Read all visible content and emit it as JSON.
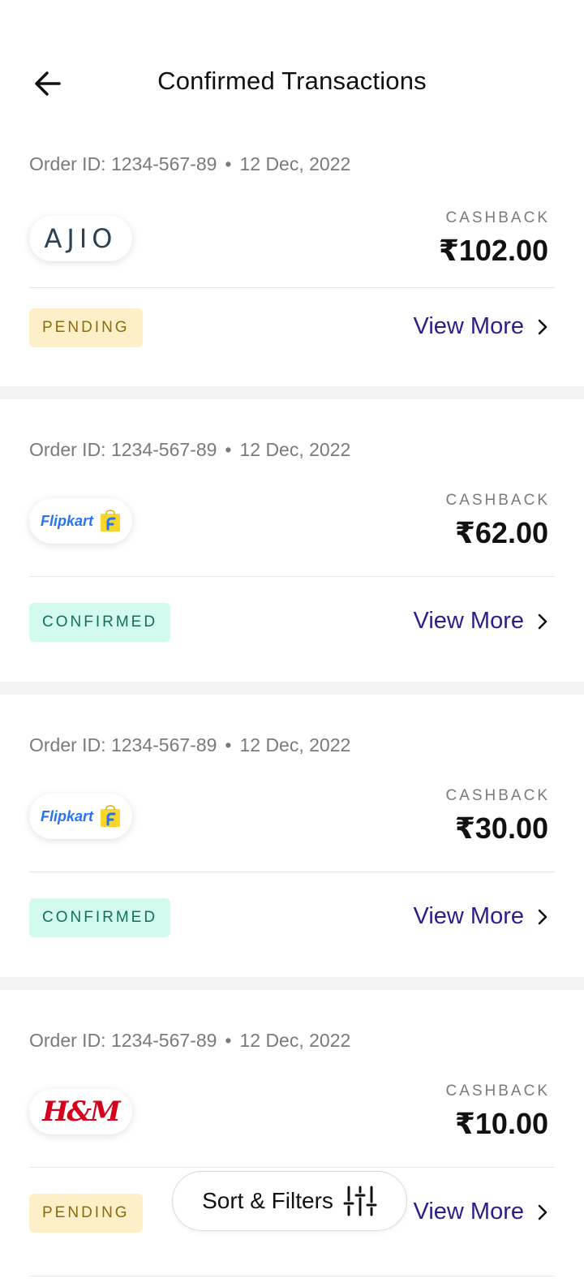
{
  "header": {
    "title": "Confirmed Transactions"
  },
  "labels": {
    "cashback": "CASHBACK",
    "view_more": "View More",
    "separator": "•"
  },
  "transactions": [
    {
      "order_id": "Order ID: 1234-567-89",
      "date": "12 Dec, 2022",
      "merchant": "AJIO",
      "amount": "₹102.00",
      "status": "PENDING"
    },
    {
      "order_id": "Order ID: 1234-567-89",
      "date": "12 Dec, 2022",
      "merchant": "Flipkart",
      "amount": "₹62.00",
      "status": "CONFIRMED"
    },
    {
      "order_id": "Order ID: 1234-567-89",
      "date": "12 Dec, 2022",
      "merchant": "Flipkart",
      "amount": "₹30.00",
      "status": "CONFIRMED"
    },
    {
      "order_id": "Order ID: 1234-567-89",
      "date": "12 Dec, 2022",
      "merchant": "H&M",
      "amount": "₹10.00",
      "status": "PENDING"
    }
  ],
  "footer": {
    "sort_filters_label": "Sort & Filters"
  },
  "icons": {
    "back": "arrow-left-icon",
    "chevron": "chevron-right-icon",
    "filters": "sliders-icon"
  },
  "colors": {
    "accent": "#2b1d8c",
    "pending_bg": "#fdefc8",
    "pending_text": "#8a6a12",
    "confirmed_bg": "#d3faef",
    "confirmed_text": "#127058",
    "flipkart_blue": "#2874f0",
    "flipkart_yellow": "#f8d62b",
    "hm_red": "#d6001c",
    "ajio_navy": "#2c4152"
  }
}
